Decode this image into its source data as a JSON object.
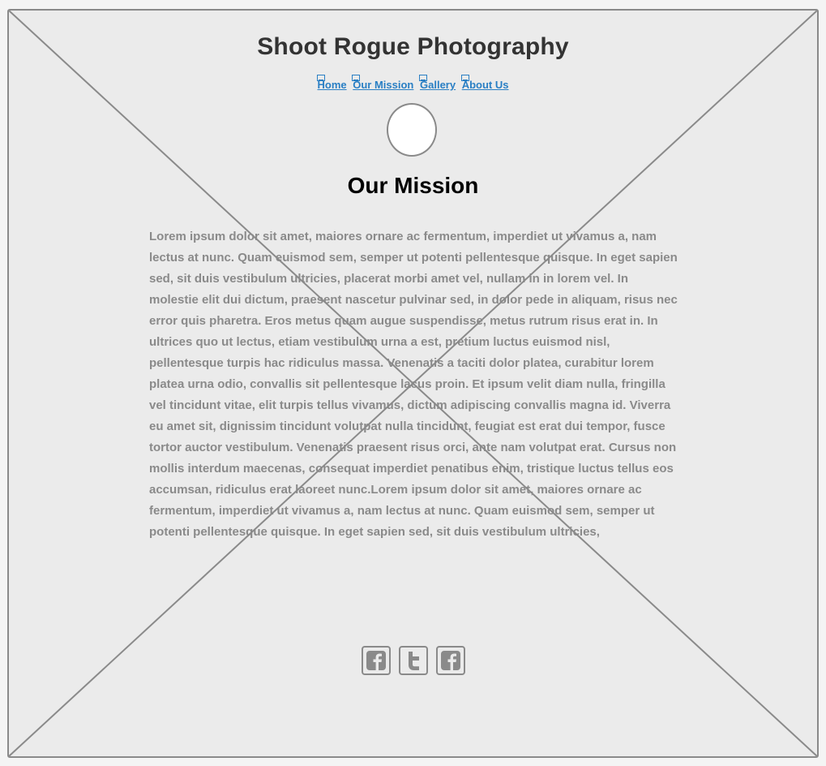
{
  "site": {
    "title": "Shoot Rogue Photography"
  },
  "nav": {
    "items": [
      {
        "label": "Home"
      },
      {
        "label": "Our Mission"
      },
      {
        "label": "Gallery"
      },
      {
        "label": "About Us"
      }
    ]
  },
  "main": {
    "heading": "Our Mission",
    "body": "Lorem ipsum dolor sit amet, maiores ornare ac fermentum, imperdiet ut vivamus a, nam lectus at nunc. Quam euismod sem, semper ut potenti pellentesque quisque. In eget sapien sed, sit duis vestibulum ultricies, placerat morbi amet vel, nullam in in lorem vel. In molestie elit dui dictum, praesent nascetur pulvinar sed, in dolor pede in aliquam, risus nec error quis pharetra. Eros metus quam augue suspendisse, metus rutrum risus erat in. In ultrices quo ut lectus, etiam vestibulum urna a est, pretium luctus euismod nisl, pellentesque turpis hac ridiculus massa. Venenatis a taciti dolor platea, curabitur lorem platea urna odio, convallis sit pellentesque lacus proin. Et ipsum velit diam nulla, fringilla vel tincidunt vitae, elit turpis tellus vivamus, dictum adipiscing convallis magna id. Viverra eu amet sit, dignissim tincidunt volutpat nulla tincidunt, feugiat est erat dui tempor, fusce tortor auctor vestibulum. Venenatis praesent risus orci, ante nam volutpat erat. Cursus non mollis interdum maecenas, consequat imperdiet penatibus enim, tristique luctus tellus eos accumsan, ridiculus erat laoreet nunc.Lorem ipsum dolor sit amet, maiores ornare ac fermentum, imperdiet ut vivamus a, nam lectus at nunc. Quam euismod sem, semper ut potenti pellentesque quisque. In eget sapien sed, sit duis vestibulum ultricies,"
  },
  "social": {
    "icons": [
      "facebook-icon",
      "twitter-icon",
      "facebook-icon"
    ]
  },
  "colors": {
    "link": "#2a7fc4",
    "border": "#8a8a8a",
    "background": "#ebebeb"
  }
}
